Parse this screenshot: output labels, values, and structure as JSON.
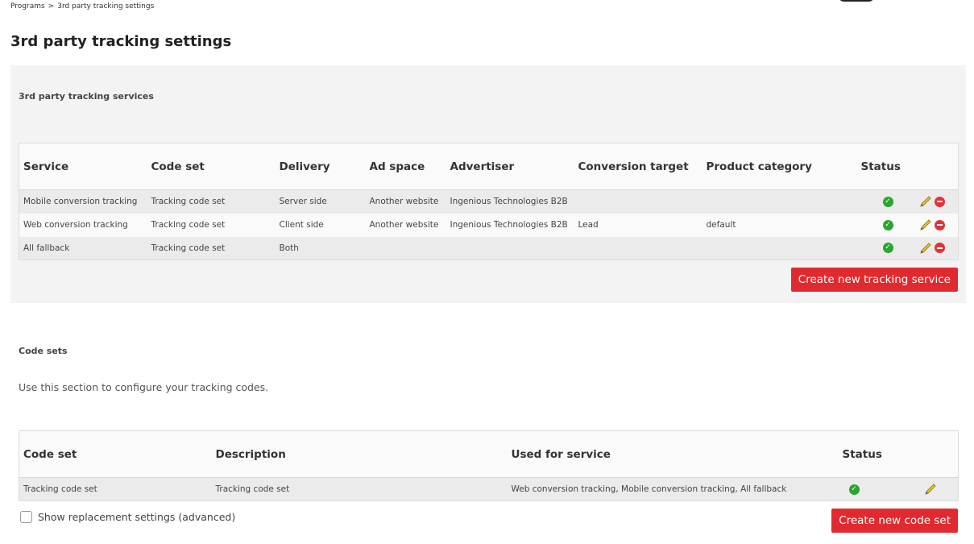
{
  "breadcrumb": {
    "items": [
      "Programs",
      "3rd party tracking settings"
    ],
    "separator": ">"
  },
  "page": {
    "title": "3rd party tracking settings"
  },
  "colors": {
    "accent": "#e02a2f",
    "status_ok": "#2aa52f",
    "delete": "#e0333a"
  },
  "services": {
    "heading": "3rd party tracking services",
    "columns": [
      "Service",
      "Code set",
      "Delivery",
      "Ad space",
      "Advertiser",
      "Conversion target",
      "Product category",
      "Status"
    ],
    "rows": [
      {
        "service": "Mobile conversion tracking",
        "code_set": "Tracking code set",
        "delivery": "Server side",
        "ad_space": "Another website",
        "advertiser": "Ingenious Technologies B2B",
        "conversion_target": "",
        "product_category": "",
        "status_icon": "check-circle-icon"
      },
      {
        "service": "Web conversion tracking",
        "code_set": "Tracking code set",
        "delivery": "Client side",
        "ad_space": "Another website",
        "advertiser": "Ingenious Technologies B2B",
        "conversion_target": "Lead",
        "product_category": "default",
        "status_icon": "check-circle-icon"
      },
      {
        "service": "All fallback",
        "code_set": "Tracking code set",
        "delivery": "Both",
        "ad_space": "",
        "advertiser": "",
        "conversion_target": "",
        "product_category": "",
        "status_icon": "check-circle-icon"
      }
    ],
    "create_button": "Create new tracking service"
  },
  "code_sets": {
    "heading": "Code sets",
    "description": "Use this section to configure your tracking codes.",
    "columns": [
      "Code set",
      "Description",
      "Used for service",
      "Status"
    ],
    "rows": [
      {
        "code_set": "Tracking code set",
        "description": "Tracking code set",
        "used_for": "Web conversion tracking, Mobile conversion tracking, All fallback",
        "status_icon": "check-circle-icon"
      }
    ],
    "advanced_label": "Show replacement settings (advanced)",
    "create_button": "Create new code set"
  }
}
